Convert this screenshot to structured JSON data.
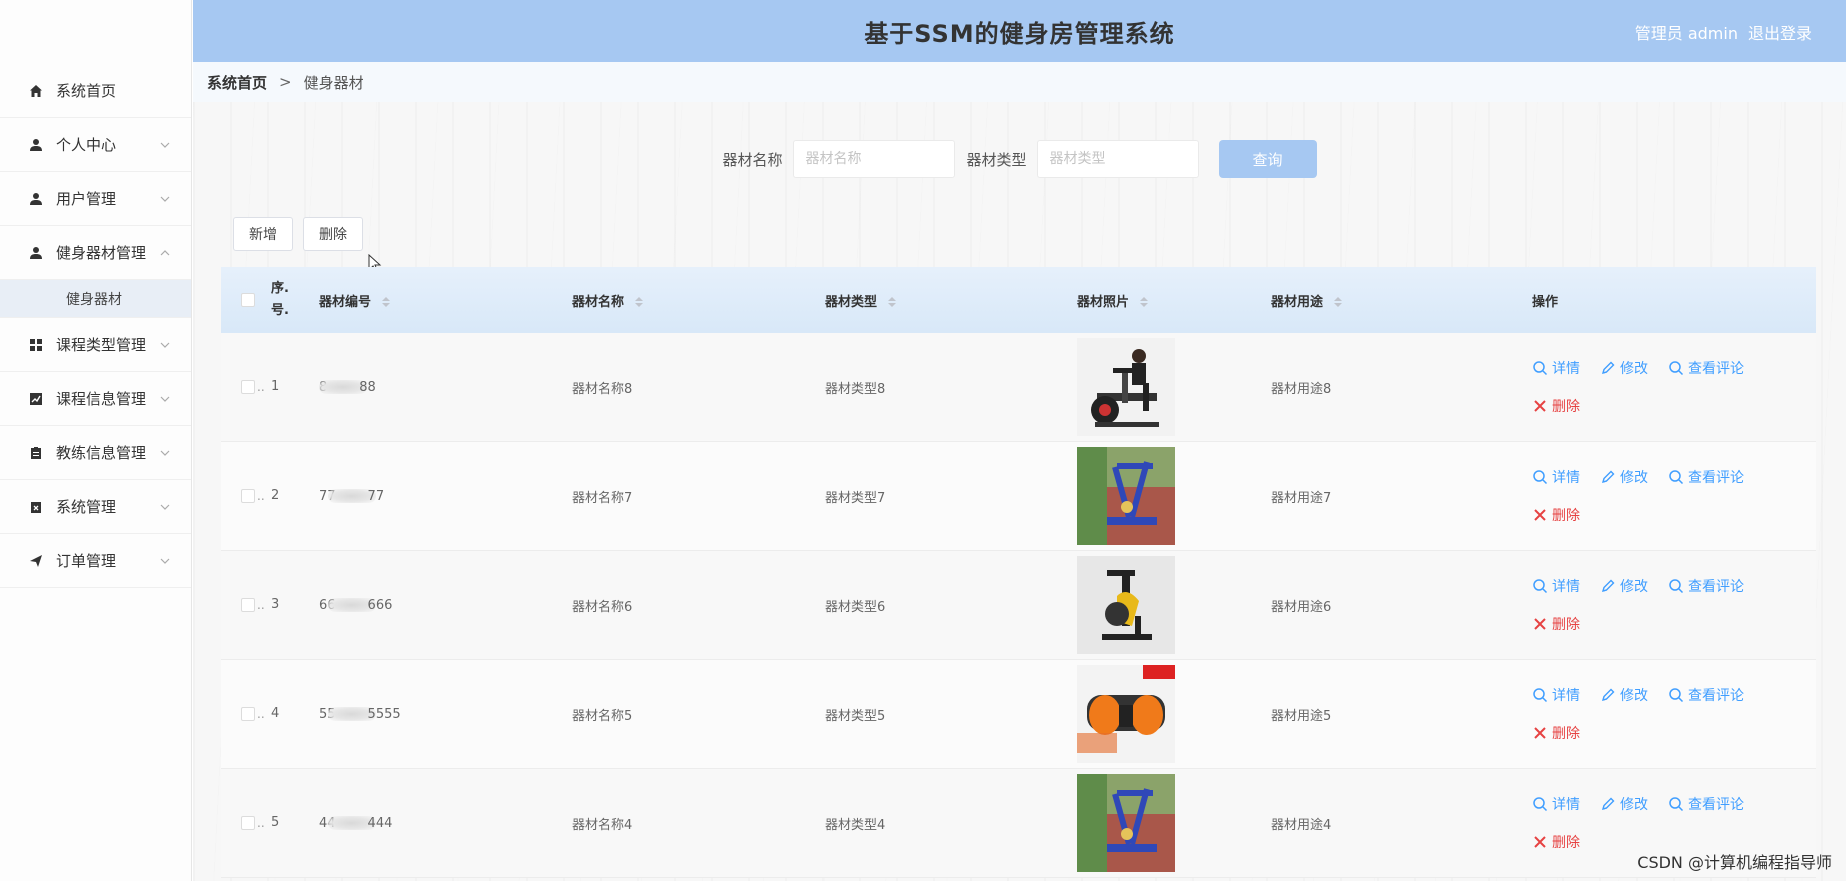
{
  "app": {
    "title": "基于SSM的健身房管理系统",
    "user_label": "管理员 admin",
    "logout_label": "退出登录"
  },
  "breadcrumb": {
    "home": "系统首页",
    "separator": ">",
    "current": "健身器材"
  },
  "sidebar": {
    "items": [
      {
        "label": "系统首页",
        "icon": "home-icon"
      },
      {
        "label": "个人中心",
        "icon": "user-icon"
      },
      {
        "label": "用户管理",
        "icon": "user-icon"
      },
      {
        "label": "健身器材管理",
        "icon": "user-icon"
      },
      {
        "label": "课程类型管理",
        "icon": "grid-icon"
      },
      {
        "label": "课程信息管理",
        "icon": "chart-icon"
      },
      {
        "label": "教练信息管理",
        "icon": "clipboard-icon"
      },
      {
        "label": "系统管理",
        "icon": "calendar-x-icon"
      },
      {
        "label": "订单管理",
        "icon": "send-icon"
      }
    ],
    "active_submenu": "健身器材"
  },
  "search": {
    "name_label": "器材名称",
    "name_placeholder": "器材名称",
    "type_label": "器材类型",
    "type_placeholder": "器材类型",
    "button": "查询"
  },
  "actions": {
    "add": "新增",
    "delete": "删除"
  },
  "table": {
    "headers": {
      "index": "序号",
      "code": "器材编号",
      "name": "器材名称",
      "type": "器材类型",
      "photo": "器材照片",
      "use": "器材用途",
      "ops": "操作"
    },
    "rows": [
      {
        "index": "1",
        "code_pre": "8",
        "code_post": "88",
        "name": "器材名称8",
        "type": "器材类型8",
        "use": "器材用途8",
        "photo": "exercise-bike-person"
      },
      {
        "index": "2",
        "code_pre": "77",
        "code_post": "77",
        "name": "器材名称7",
        "type": "器材类型7",
        "use": "器材用途7",
        "photo": "outdoor-blue-equipment"
      },
      {
        "index": "3",
        "code_pre": "66",
        "code_post": "666",
        "name": "器材名称6",
        "type": "器材类型6",
        "use": "器材用途6",
        "photo": "spin-bike-yellow"
      },
      {
        "index": "4",
        "code_pre": "55",
        "code_post": "5555",
        "name": "器材名称5",
        "type": "器材类型5",
        "use": "器材用途5",
        "photo": "ab-roller-orange"
      },
      {
        "index": "5",
        "code_pre": "44",
        "code_post": "444",
        "name": "器材名称4",
        "type": "器材类型4",
        "use": "器材用途4",
        "photo": "outdoor-blue-equipment"
      }
    ],
    "ops": {
      "detail": "详情",
      "edit": "修改",
      "comments": "查看评论",
      "delete": "删除"
    }
  },
  "watermark": "CSDN @计算机编程指导师",
  "colors": {
    "header_bg": "#a6c8f2",
    "accent": "#409eff",
    "danger": "#e64242"
  }
}
